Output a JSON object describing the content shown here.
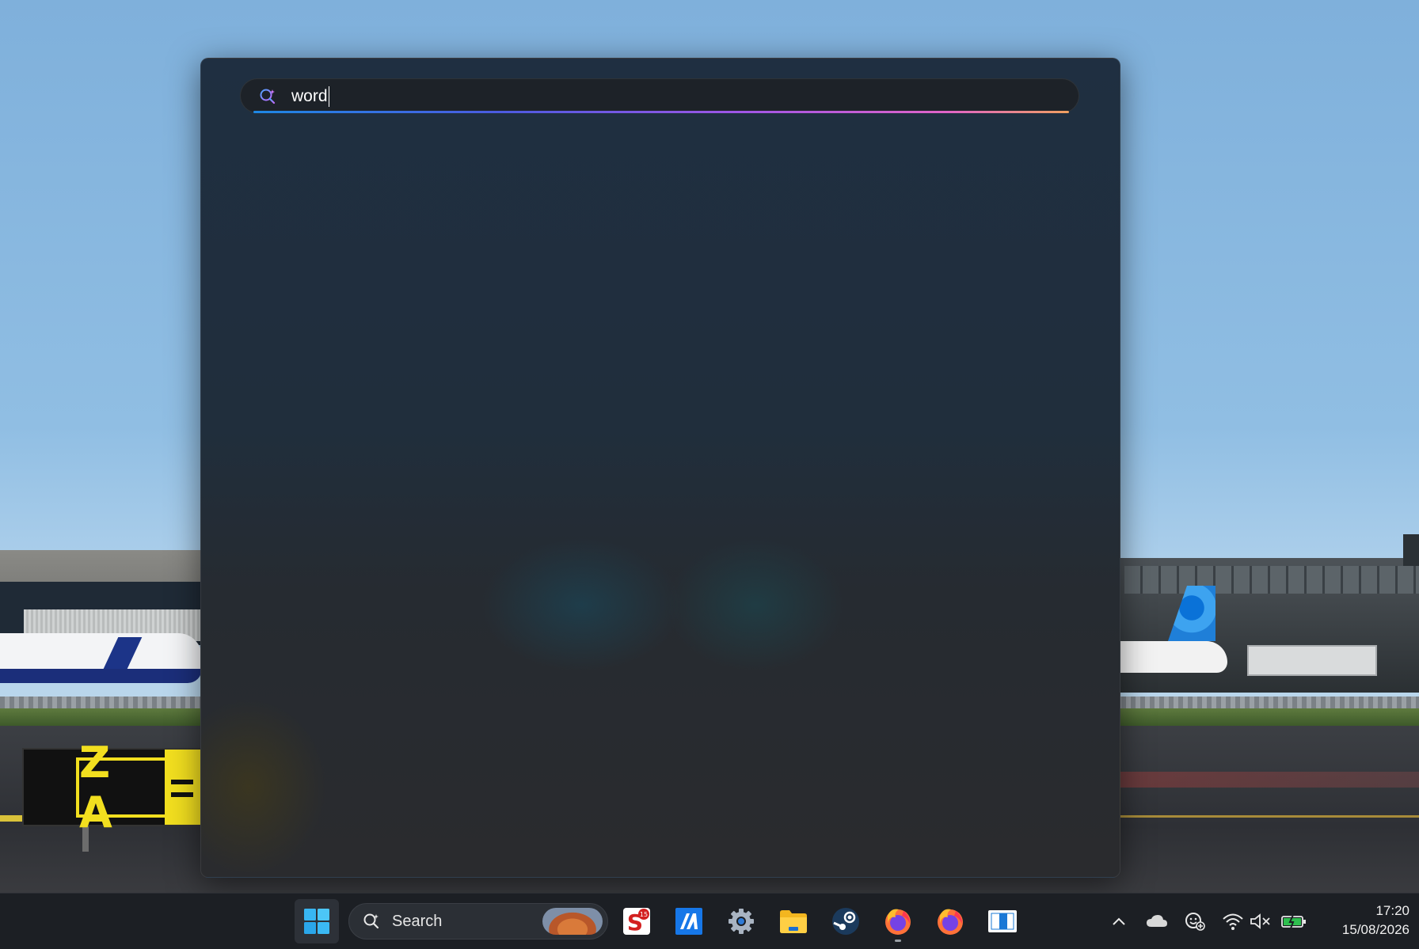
{
  "search_flyout": {
    "query_value": "word"
  },
  "taskbar": {
    "search_label": "Search",
    "apps": [
      {
        "name": "start-button"
      },
      {
        "name": "app-s-badge"
      },
      {
        "name": "app-blue-ia"
      },
      {
        "name": "app-settings"
      },
      {
        "name": "app-file-explorer"
      },
      {
        "name": "app-steam"
      },
      {
        "name": "app-firefox-running"
      },
      {
        "name": "app-firefox"
      },
      {
        "name": "app-blue-window"
      }
    ],
    "s_badge_count": "15"
  },
  "tray": {
    "time": "17:20",
    "date": "15/08/2026"
  },
  "wallpaper": {
    "sign_text": "Z A"
  }
}
